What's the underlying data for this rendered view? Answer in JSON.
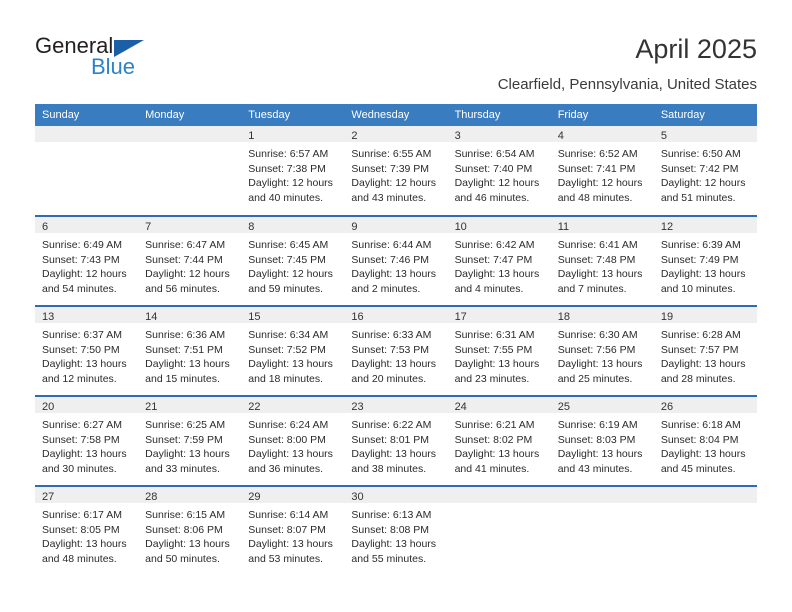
{
  "brand": {
    "name_part1": "General",
    "name_part2": "Blue",
    "flag_icon": "triangle-flag-icon",
    "accent_color": "#2e82c8",
    "flag_color": "#1a5fa8"
  },
  "header": {
    "title": "April 2025",
    "location": "Clearfield, Pennsylvania, United States"
  },
  "theme": {
    "header_blue": "#3a7cc0",
    "row_divider_blue": "#2e6db4",
    "daynum_band": "#efefef"
  },
  "weekdays": [
    "Sunday",
    "Monday",
    "Tuesday",
    "Wednesday",
    "Thursday",
    "Friday",
    "Saturday"
  ],
  "labels": {
    "sunrise_prefix": "Sunrise:",
    "sunset_prefix": "Sunset:",
    "daylight_prefix": "Daylight:"
  },
  "weeks": [
    [
      {
        "day": "",
        "sunrise": "",
        "sunset": "",
        "daylight_line1": "",
        "daylight_line2": ""
      },
      {
        "day": "",
        "sunrise": "",
        "sunset": "",
        "daylight_line1": "",
        "daylight_line2": ""
      },
      {
        "day": "1",
        "sunrise": "Sunrise: 6:57 AM",
        "sunset": "Sunset: 7:38 PM",
        "daylight_line1": "Daylight: 12 hours",
        "daylight_line2": "and 40 minutes."
      },
      {
        "day": "2",
        "sunrise": "Sunrise: 6:55 AM",
        "sunset": "Sunset: 7:39 PM",
        "daylight_line1": "Daylight: 12 hours",
        "daylight_line2": "and 43 minutes."
      },
      {
        "day": "3",
        "sunrise": "Sunrise: 6:54 AM",
        "sunset": "Sunset: 7:40 PM",
        "daylight_line1": "Daylight: 12 hours",
        "daylight_line2": "and 46 minutes."
      },
      {
        "day": "4",
        "sunrise": "Sunrise: 6:52 AM",
        "sunset": "Sunset: 7:41 PM",
        "daylight_line1": "Daylight: 12 hours",
        "daylight_line2": "and 48 minutes."
      },
      {
        "day": "5",
        "sunrise": "Sunrise: 6:50 AM",
        "sunset": "Sunset: 7:42 PM",
        "daylight_line1": "Daylight: 12 hours",
        "daylight_line2": "and 51 minutes."
      }
    ],
    [
      {
        "day": "6",
        "sunrise": "Sunrise: 6:49 AM",
        "sunset": "Sunset: 7:43 PM",
        "daylight_line1": "Daylight: 12 hours",
        "daylight_line2": "and 54 minutes."
      },
      {
        "day": "7",
        "sunrise": "Sunrise: 6:47 AM",
        "sunset": "Sunset: 7:44 PM",
        "daylight_line1": "Daylight: 12 hours",
        "daylight_line2": "and 56 minutes."
      },
      {
        "day": "8",
        "sunrise": "Sunrise: 6:45 AM",
        "sunset": "Sunset: 7:45 PM",
        "daylight_line1": "Daylight: 12 hours",
        "daylight_line2": "and 59 minutes."
      },
      {
        "day": "9",
        "sunrise": "Sunrise: 6:44 AM",
        "sunset": "Sunset: 7:46 PM",
        "daylight_line1": "Daylight: 13 hours",
        "daylight_line2": "and 2 minutes."
      },
      {
        "day": "10",
        "sunrise": "Sunrise: 6:42 AM",
        "sunset": "Sunset: 7:47 PM",
        "daylight_line1": "Daylight: 13 hours",
        "daylight_line2": "and 4 minutes."
      },
      {
        "day": "11",
        "sunrise": "Sunrise: 6:41 AM",
        "sunset": "Sunset: 7:48 PM",
        "daylight_line1": "Daylight: 13 hours",
        "daylight_line2": "and 7 minutes."
      },
      {
        "day": "12",
        "sunrise": "Sunrise: 6:39 AM",
        "sunset": "Sunset: 7:49 PM",
        "daylight_line1": "Daylight: 13 hours",
        "daylight_line2": "and 10 minutes."
      }
    ],
    [
      {
        "day": "13",
        "sunrise": "Sunrise: 6:37 AM",
        "sunset": "Sunset: 7:50 PM",
        "daylight_line1": "Daylight: 13 hours",
        "daylight_line2": "and 12 minutes."
      },
      {
        "day": "14",
        "sunrise": "Sunrise: 6:36 AM",
        "sunset": "Sunset: 7:51 PM",
        "daylight_line1": "Daylight: 13 hours",
        "daylight_line2": "and 15 minutes."
      },
      {
        "day": "15",
        "sunrise": "Sunrise: 6:34 AM",
        "sunset": "Sunset: 7:52 PM",
        "daylight_line1": "Daylight: 13 hours",
        "daylight_line2": "and 18 minutes."
      },
      {
        "day": "16",
        "sunrise": "Sunrise: 6:33 AM",
        "sunset": "Sunset: 7:53 PM",
        "daylight_line1": "Daylight: 13 hours",
        "daylight_line2": "and 20 minutes."
      },
      {
        "day": "17",
        "sunrise": "Sunrise: 6:31 AM",
        "sunset": "Sunset: 7:55 PM",
        "daylight_line1": "Daylight: 13 hours",
        "daylight_line2": "and 23 minutes."
      },
      {
        "day": "18",
        "sunrise": "Sunrise: 6:30 AM",
        "sunset": "Sunset: 7:56 PM",
        "daylight_line1": "Daylight: 13 hours",
        "daylight_line2": "and 25 minutes."
      },
      {
        "day": "19",
        "sunrise": "Sunrise: 6:28 AM",
        "sunset": "Sunset: 7:57 PM",
        "daylight_line1": "Daylight: 13 hours",
        "daylight_line2": "and 28 minutes."
      }
    ],
    [
      {
        "day": "20",
        "sunrise": "Sunrise: 6:27 AM",
        "sunset": "Sunset: 7:58 PM",
        "daylight_line1": "Daylight: 13 hours",
        "daylight_line2": "and 30 minutes."
      },
      {
        "day": "21",
        "sunrise": "Sunrise: 6:25 AM",
        "sunset": "Sunset: 7:59 PM",
        "daylight_line1": "Daylight: 13 hours",
        "daylight_line2": "and 33 minutes."
      },
      {
        "day": "22",
        "sunrise": "Sunrise: 6:24 AM",
        "sunset": "Sunset: 8:00 PM",
        "daylight_line1": "Daylight: 13 hours",
        "daylight_line2": "and 36 minutes."
      },
      {
        "day": "23",
        "sunrise": "Sunrise: 6:22 AM",
        "sunset": "Sunset: 8:01 PM",
        "daylight_line1": "Daylight: 13 hours",
        "daylight_line2": "and 38 minutes."
      },
      {
        "day": "24",
        "sunrise": "Sunrise: 6:21 AM",
        "sunset": "Sunset: 8:02 PM",
        "daylight_line1": "Daylight: 13 hours",
        "daylight_line2": "and 41 minutes."
      },
      {
        "day": "25",
        "sunrise": "Sunrise: 6:19 AM",
        "sunset": "Sunset: 8:03 PM",
        "daylight_line1": "Daylight: 13 hours",
        "daylight_line2": "and 43 minutes."
      },
      {
        "day": "26",
        "sunrise": "Sunrise: 6:18 AM",
        "sunset": "Sunset: 8:04 PM",
        "daylight_line1": "Daylight: 13 hours",
        "daylight_line2": "and 45 minutes."
      }
    ],
    [
      {
        "day": "27",
        "sunrise": "Sunrise: 6:17 AM",
        "sunset": "Sunset: 8:05 PM",
        "daylight_line1": "Daylight: 13 hours",
        "daylight_line2": "and 48 minutes."
      },
      {
        "day": "28",
        "sunrise": "Sunrise: 6:15 AM",
        "sunset": "Sunset: 8:06 PM",
        "daylight_line1": "Daylight: 13 hours",
        "daylight_line2": "and 50 minutes."
      },
      {
        "day": "29",
        "sunrise": "Sunrise: 6:14 AM",
        "sunset": "Sunset: 8:07 PM",
        "daylight_line1": "Daylight: 13 hours",
        "daylight_line2": "and 53 minutes."
      },
      {
        "day": "30",
        "sunrise": "Sunrise: 6:13 AM",
        "sunset": "Sunset: 8:08 PM",
        "daylight_line1": "Daylight: 13 hours",
        "daylight_line2": "and 55 minutes."
      },
      {
        "day": "",
        "sunrise": "",
        "sunset": "",
        "daylight_line1": "",
        "daylight_line2": ""
      },
      {
        "day": "",
        "sunrise": "",
        "sunset": "",
        "daylight_line1": "",
        "daylight_line2": ""
      },
      {
        "day": "",
        "sunrise": "",
        "sunset": "",
        "daylight_line1": "",
        "daylight_line2": ""
      }
    ]
  ]
}
